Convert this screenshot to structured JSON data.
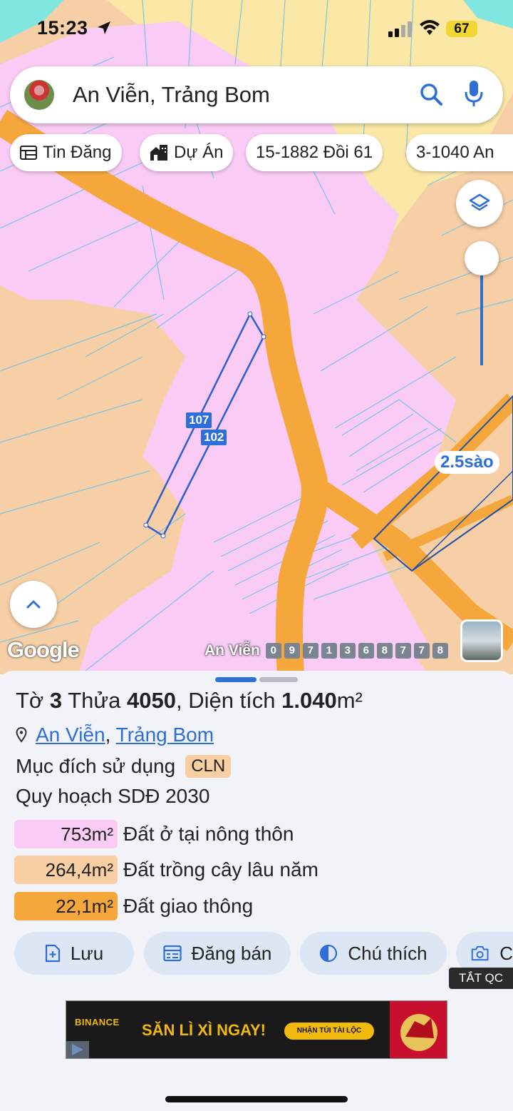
{
  "status": {
    "time": "15:23",
    "battery": "67"
  },
  "search": {
    "query": "An Viễn, Trảng Bom"
  },
  "chips": [
    {
      "label": "Tin Đăng",
      "icon": "listing-icon"
    },
    {
      "label": "Dự Án",
      "icon": "project-building-icon"
    },
    {
      "label": "15-1882 Đồi 61",
      "icon": ""
    },
    {
      "label": "3-1040 An",
      "icon": ""
    }
  ],
  "map": {
    "area_badge": "2.5sào",
    "parcel_labels": [
      "107",
      "102"
    ],
    "google_logo": "Google",
    "place_name": "An Viễn",
    "place_digits": [
      "0",
      "9",
      "7",
      "1",
      "3",
      "6",
      "8",
      "7",
      "7",
      "8"
    ],
    "colors": {
      "residential": "#f9cbf5",
      "perennial": "#f6cfa6",
      "road": "#f5a73b",
      "water": "#7fe6e0",
      "forest": "#fbe7a6",
      "selection": "#2d5ed0"
    }
  },
  "parcel": {
    "title_prefix": "Tờ",
    "sheet_no": "3",
    "parcel_word": "Thửa",
    "parcel_no": "4050",
    "area_label": ", Diện tích",
    "area_value": "1.040",
    "area_unit": "m²",
    "location_commune": "An Viễn",
    "location_separator": ",",
    "location_district": "Trảng Bom",
    "usage_label": "Mục đích sử dụng",
    "usage_code": "CLN",
    "plan_label": "Quy hoạch SDĐ 2030",
    "land_uses": [
      {
        "area": "753m²",
        "label": "Đất ở tại nông thôn",
        "color": "#f9cbf5"
      },
      {
        "area": "264,4m²",
        "label": "Đất trồng cây lâu năm",
        "color": "#f7cfa2"
      },
      {
        "area": "22,1m²",
        "label": "Đất giao thông",
        "color": "#f5a73b"
      }
    ]
  },
  "actions": [
    {
      "label": "Lưu",
      "icon": "add-document-icon"
    },
    {
      "label": "Đăng bán",
      "icon": "calendar-list-icon"
    },
    {
      "label": "Chú thích",
      "icon": "half-circle-icon"
    },
    {
      "label": "C",
      "icon": "camera-add-icon"
    }
  ],
  "ad": {
    "toggle_label": "TẮT QC",
    "brand": "BINANCE",
    "headline": "SĂN LÌ XÌ NGAY!",
    "cta": "NHẬN TÚI TÀI LỘC"
  }
}
